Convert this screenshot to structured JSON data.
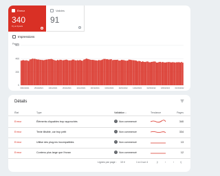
{
  "tiles": {
    "error": {
      "label": "Erreur",
      "value": "340",
      "sub": "Il y a 3 jours",
      "color": "#d93025"
    },
    "warning": {
      "label": "Valides",
      "value": "91"
    }
  },
  "impressions_label": "Impressions",
  "chart_data": {
    "type": "bar",
    "ylabel": "Pages",
    "ylim": [
      0,
      600
    ],
    "yticks": [
      "600",
      "400",
      "200",
      "0"
    ],
    "xticks": [
      "09/10/2021",
      "25/10/2021",
      "10/11/2021",
      "26/11/2021",
      "12/12/2021",
      "28/12/2021",
      "13/01/2022",
      "29/01/2022",
      "14/02/2022",
      "02/03/2022",
      "18/03/2022",
      "01/03/2022"
    ],
    "bar_color": "#d93025",
    "values": [
      370,
      376,
      378,
      372,
      376,
      372,
      366,
      388,
      392,
      400,
      398,
      398,
      392,
      388,
      388,
      384,
      382,
      380,
      377,
      382,
      386,
      388,
      392,
      392,
      396,
      390,
      382,
      376,
      372,
      382,
      376,
      384,
      382,
      376,
      378,
      382,
      386,
      380,
      374,
      374,
      376,
      386,
      386,
      376,
      374,
      378,
      374,
      382,
      372,
      370,
      386,
      392,
      402,
      396,
      392,
      386,
      382,
      382,
      380,
      376,
      374,
      372,
      380,
      376,
      380,
      388,
      396,
      396,
      392,
      392,
      386,
      390,
      392,
      378,
      382,
      382,
      382,
      384,
      372,
      372,
      382,
      380,
      378,
      372,
      370,
      372,
      386,
      384,
      380,
      378,
      376,
      374,
      370,
      360,
      366,
      362,
      352,
      360,
      352,
      350,
      356,
      358,
      348,
      346,
      352,
      354,
      358,
      356,
      342,
      342,
      350,
      352,
      346,
      350,
      344,
      342,
      346,
      348,
      350,
      346,
      344,
      348,
      345,
      342,
      346,
      346,
      348,
      342,
      350,
      340
    ]
  },
  "details": {
    "title": "Détails",
    "columns": [
      "État",
      "Type",
      "Validation",
      "Tendance",
      "Pages"
    ],
    "rows": [
      {
        "state": "Erreur",
        "type": "Éléments cliquables trop rapprochés",
        "validation": "Non commencé",
        "pages": "340"
      },
      {
        "state": "Erreur",
        "type": "Texte illisible, car trop petit",
        "validation": "Non commencé",
        "pages": "334"
      },
      {
        "state": "Erreur",
        "type": "Utilise des plug-ins incompatibles",
        "validation": "Non commencé",
        "pages": "13"
      },
      {
        "state": "Erreur",
        "type": "Contenu plus large que l'écran",
        "validation": "Non commencé",
        "pages": "12"
      }
    ],
    "pager": {
      "rows_label": "Lignes par page :",
      "rows_value": "10",
      "range": "1 à 4 sur 4"
    }
  }
}
